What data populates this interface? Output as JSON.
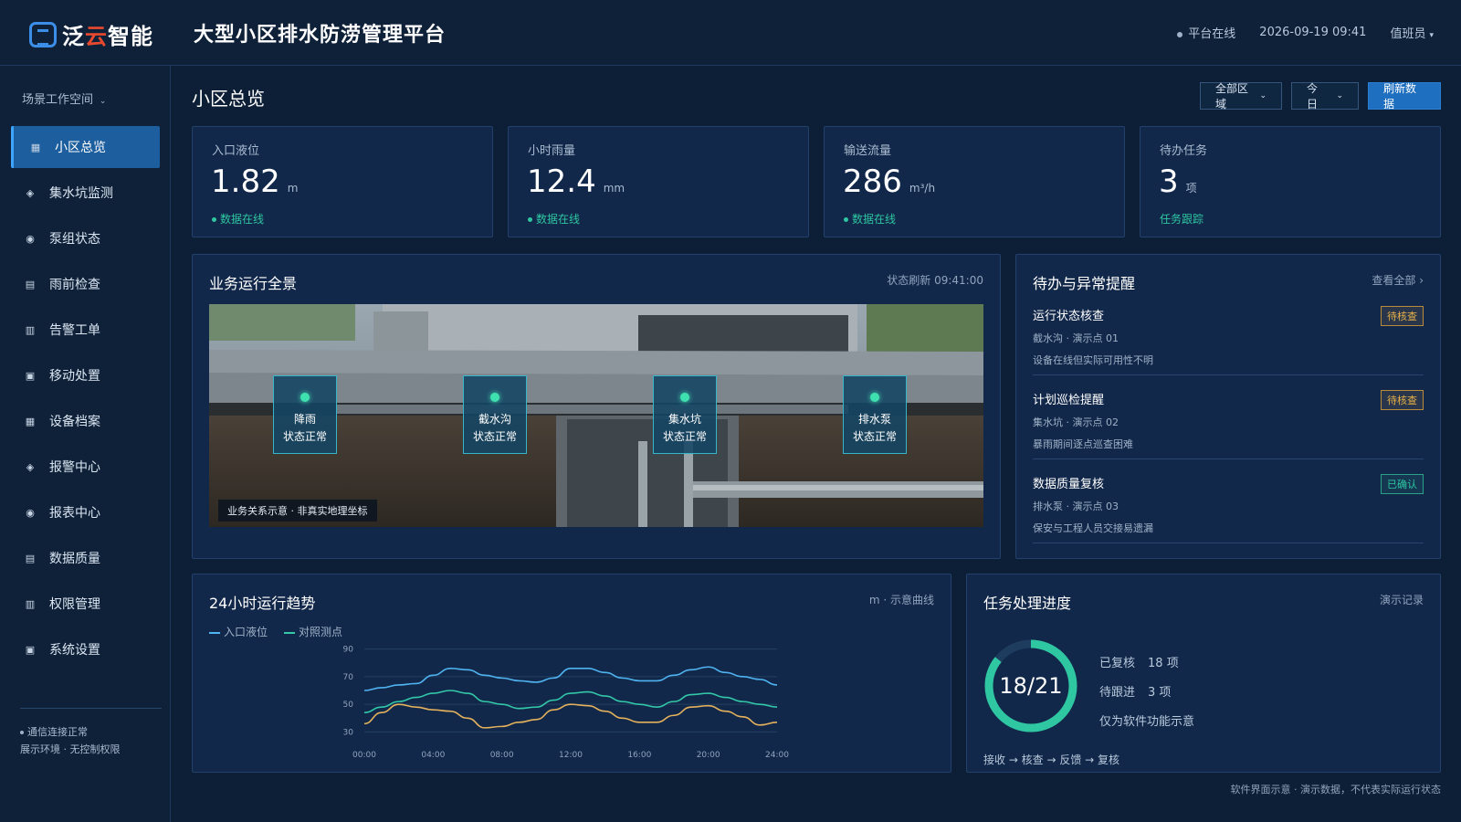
{
  "header": {
    "brand_main": "泛",
    "brand_accent": "云",
    "brand_rest": "智能",
    "title": "大型小区排水防涝管理平台",
    "status": "平台在线",
    "datetime": "2026-09-19 09:41",
    "user": "值班员"
  },
  "sidebar": {
    "workspace": "场景工作空间",
    "items": [
      {
        "label": "小区总览",
        "icon": "grid-icon"
      },
      {
        "label": "集水坑监测",
        "icon": "diamond-icon"
      },
      {
        "label": "泵组状态",
        "icon": "target-icon"
      },
      {
        "label": "雨前检查",
        "icon": "list-icon"
      },
      {
        "label": "告警工单",
        "icon": "table-icon"
      },
      {
        "label": "移动处置",
        "icon": "square-icon"
      },
      {
        "label": "设备档案",
        "icon": "grid-icon"
      },
      {
        "label": "报警中心",
        "icon": "diamond-icon"
      },
      {
        "label": "报表中心",
        "icon": "target-icon"
      },
      {
        "label": "数据质量",
        "icon": "list-icon"
      },
      {
        "label": "权限管理",
        "icon": "table-icon"
      },
      {
        "label": "系统设置",
        "icon": "square-icon"
      }
    ],
    "foot_status": "通信连接正常",
    "foot_note": "展示环境 · 无控制权限"
  },
  "main": {
    "title": "小区总览",
    "filters": {
      "area": "全部区域",
      "range": "今日",
      "refresh": "刷新数据"
    }
  },
  "kpis": [
    {
      "label": "入口液位",
      "value": "1.82",
      "unit": "m",
      "foot": "数据在线"
    },
    {
      "label": "小时雨量",
      "value": "12.4",
      "unit": "mm",
      "foot": "数据在线"
    },
    {
      "label": "输送流量",
      "value": "286",
      "unit": "m³/h",
      "foot": "数据在线"
    },
    {
      "label": "待办任务",
      "value": "3",
      "unit": "项",
      "foot": "任务跟踪"
    }
  ],
  "overview": {
    "title": "业务运行全景",
    "meta": "状态刷新 09:41:00",
    "markers": [
      {
        "name": "降雨",
        "status": "状态正常"
      },
      {
        "name": "截水沟",
        "status": "状态正常"
      },
      {
        "name": "集水坑",
        "status": "状态正常"
      },
      {
        "name": "排水泵",
        "status": "状态正常"
      }
    ],
    "caption": "业务关系示意 · 非真实地理坐标"
  },
  "alerts": {
    "title": "待办与异常提醒",
    "more": "查看全部",
    "items": [
      {
        "title": "运行状态核查",
        "sub": "截水沟 · 演示点 01",
        "desc": "设备在线但实际可用性不明",
        "badge": "待核查"
      },
      {
        "title": "计划巡检提醒",
        "sub": "集水坑 · 演示点 02",
        "desc": "暴雨期间逐点巡查困难",
        "badge": "待核查"
      },
      {
        "title": "数据质量复核",
        "sub": "排水泵 · 演示点 03",
        "desc": "保安与工程人员交接易遗漏",
        "badge": "已确认"
      }
    ]
  },
  "trend": {
    "title": "24小时运行趋势",
    "meta": "m · 示意曲线"
  },
  "chart_data": {
    "type": "line",
    "x": [
      "00:00",
      "01:00",
      "02:00",
      "03:00",
      "04:00",
      "05:00",
      "06:00",
      "07:00",
      "08:00",
      "09:00",
      "10:00",
      "11:00",
      "12:00",
      "13:00",
      "14:00",
      "15:00",
      "16:00",
      "17:00",
      "18:00",
      "19:00",
      "20:00",
      "21:00",
      "22:00",
      "23:00",
      "24:00"
    ],
    "x_ticks": [
      "00:00",
      "04:00",
      "08:00",
      "12:00",
      "16:00",
      "20:00",
      "24:00"
    ],
    "y_ticks": [
      90,
      70,
      50,
      30
    ],
    "ylim": [
      25,
      95
    ],
    "grid": true,
    "series": [
      {
        "name": "入口液位",
        "color": "#4fb3f0",
        "values": [
          60,
          62,
          64,
          65,
          71,
          76,
          75,
          71,
          69,
          67,
          66,
          69,
          76,
          76,
          73,
          69,
          67,
          67,
          71,
          75,
          77,
          73,
          70,
          68,
          64
        ]
      },
      {
        "name": "对照测点",
        "color": "#32c8a8",
        "values": [
          44,
          48,
          52,
          55,
          58,
          60,
          58,
          52,
          50,
          47,
          48,
          53,
          58,
          59,
          56,
          52,
          50,
          48,
          52,
          57,
          58,
          55,
          52,
          50,
          48
        ]
      },
      {
        "name": "",
        "color": "#e4b15c",
        "values": [
          36,
          44,
          50,
          48,
          46,
          45,
          40,
          33,
          34,
          37,
          39,
          46,
          50,
          49,
          45,
          40,
          37,
          37,
          42,
          48,
          49,
          45,
          41,
          35,
          37
        ]
      }
    ]
  },
  "progress": {
    "title": "任务处理进度",
    "meta": "演示记录",
    "ratio": "18/21",
    "done_label": "已复核",
    "done_value": "18 项",
    "pending_label": "待跟进",
    "pending_value": "3 项",
    "note": "仅为软件功能示意",
    "flow": "接收 → 核查 → 反馈 → 复核",
    "fraction": 0.857
  },
  "footnote": "软件界面示意 · 演示数据，不代表实际运行状态",
  "colors": {
    "accent": "#1f6fc0",
    "ok": "#2ec7a1",
    "warn": "#e8b14a",
    "bg": "#0d1f36"
  }
}
